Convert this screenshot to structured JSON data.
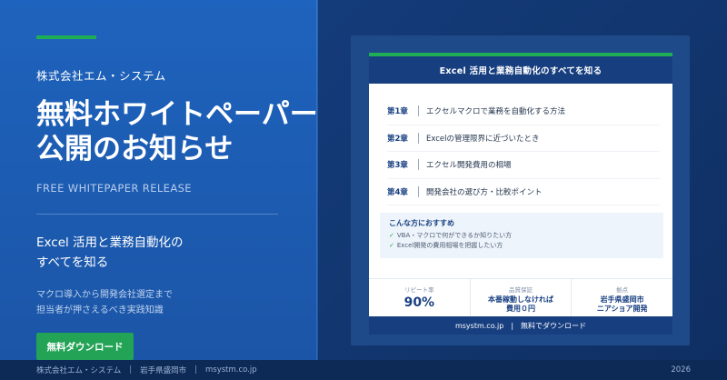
{
  "left": {
    "company": "株式会社エム・システム",
    "headline_line1": "無料ホワイトペーパー",
    "headline_line2": "公開のお知らせ",
    "english": "FREE WHITEPAPER RELEASE",
    "subtitle_line1": "Excel 活用と業務自動化の",
    "subtitle_line2": "すべてを知る",
    "desc_line1": "マクロ導入から開発会社選定まで",
    "desc_line2": "担当者が押さえるべき実践知識",
    "cta_label": "無料ダウンロード"
  },
  "doc": {
    "title": "Excel 活用と業務自動化のすべてを知る",
    "chapters": [
      {
        "num": "第1章",
        "text": "エクセルマクロで業務を自動化する方法"
      },
      {
        "num": "第2章",
        "text": "Excelの管理限界に近づいたとき"
      },
      {
        "num": "第3章",
        "text": "エクセル開発費用の相場"
      },
      {
        "num": "第4章",
        "text": "開発会社の選び方・比較ポイント"
      }
    ],
    "recommend": {
      "title": "こんな方におすすめ",
      "items": [
        "VBA・マクロで何ができるか知りたい方",
        "Excel開発の費用相場を把握したい方"
      ],
      "check_icon": "✓"
    },
    "stats": [
      {
        "label": "リピート率",
        "value": "90%"
      },
      {
        "label": "品質保証",
        "value_line1": "本番稼動しなければ",
        "value_line2": "費用０円"
      },
      {
        "label": "拠点",
        "value_line1": "岩手県盛岡市",
        "value_line2": "ニアショア開発"
      }
    ],
    "footer_site": "msystm.co.jp",
    "footer_sep": "|",
    "footer_cta": "無料でダウンロード"
  },
  "footer": {
    "company": "株式会社エム・システム",
    "sep": "|",
    "location": "岩手県盛岡市",
    "site": "msystm.co.jp",
    "year": "2026"
  },
  "colors": {
    "accent_green": "#1fae55",
    "brand_blue": "#1e63bd",
    "navy": "#173f80"
  }
}
